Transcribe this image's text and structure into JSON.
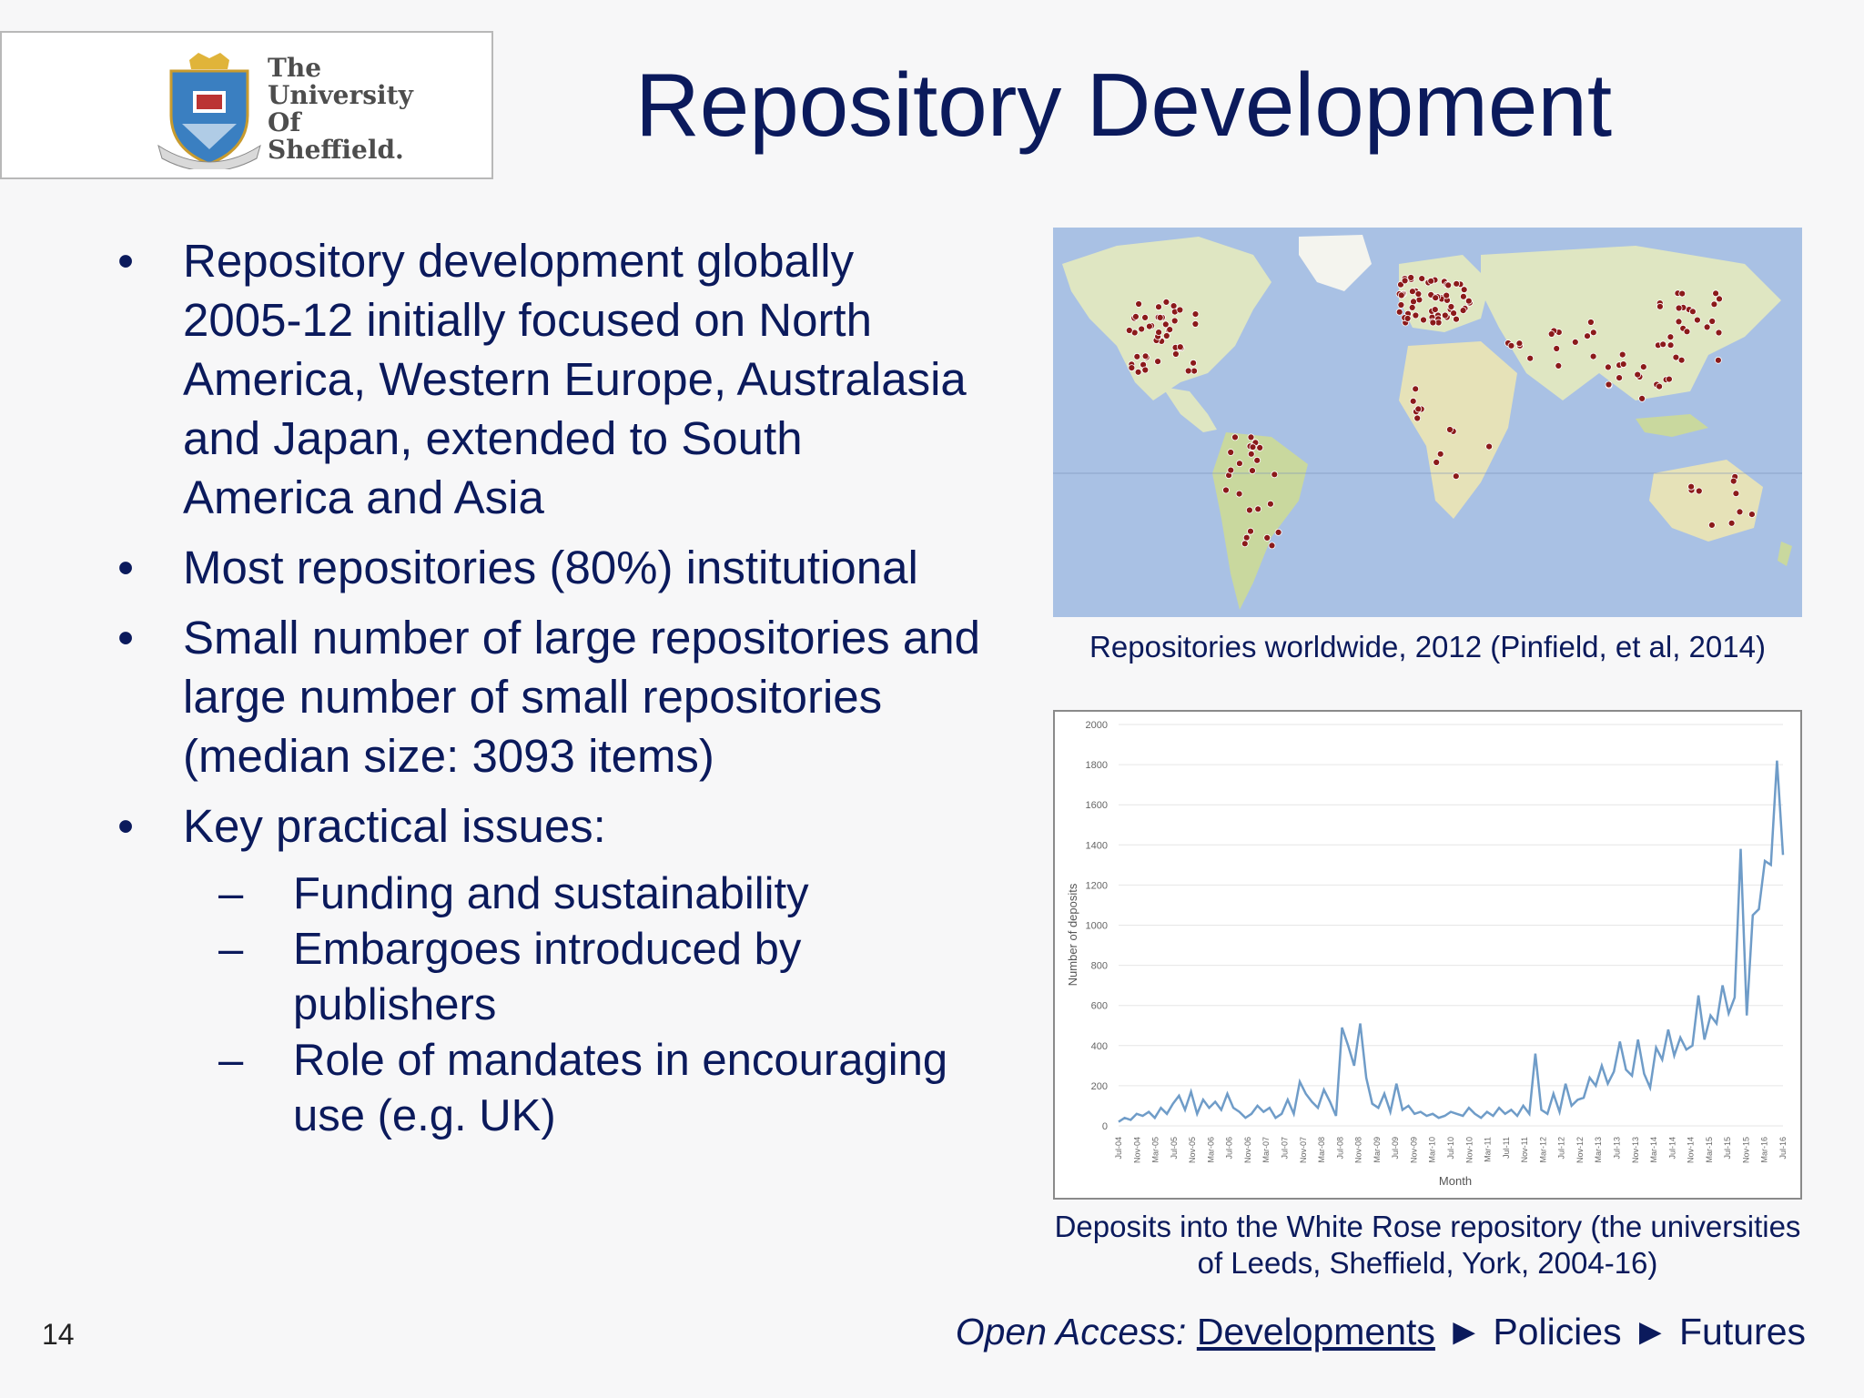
{
  "logo": {
    "lines": [
      "The",
      "University",
      "Of",
      "Sheffield."
    ]
  },
  "title": "Repository Development",
  "bullets": [
    {
      "text": "Repository development globally 2005-12 initially focused on North America, Western Europe, Australasia and Japan, extended to South America and Asia"
    },
    {
      "text": "Most repositories (80%) institutional"
    },
    {
      "text": "Small number of large repositories and large number of small repositories (median size: 3093 items)"
    },
    {
      "text": "Key practical issues:"
    }
  ],
  "sub_bullets": [
    "Funding and sustainability",
    "Embargoes introduced by publishers",
    "Role of mandates in encouraging use (e.g. UK)"
  ],
  "bullet_char": "•",
  "dash_char": "–",
  "map_caption": "Repositories worldwide, 2012 (Pinfield, et al, 2014)",
  "chart_caption": "Deposits into the White Rose repository (the universities of Leeds, Sheffield, York, 2004-16)",
  "slide_number": "14",
  "footer": {
    "prefix": "Open Access:",
    "current": "Developments",
    "arrow": "►",
    "item2": "Policies",
    "item3": "Futures"
  },
  "colors": {
    "title": "#0b1a5c",
    "ocean": "#a9c1e4",
    "land": "#dfe6c2",
    "marker": "#8b1a1a",
    "line": "#6f9cc8"
  },
  "chart_data": {
    "type": "line",
    "ylabel": "Number of deposits",
    "xlabel": "Month",
    "ylim": [
      0,
      2000
    ],
    "yticks": [
      0,
      200,
      400,
      600,
      800,
      1000,
      1200,
      1400,
      1600,
      1800,
      2000
    ],
    "xtick_labels": [
      "Jul-04",
      "Nov-04",
      "Mar-05",
      "Jul-05",
      "Nov-05",
      "Mar-06",
      "Jul-06",
      "Nov-06",
      "Mar-07",
      "Jul-07",
      "Nov-07",
      "Mar-08",
      "Jul-08",
      "Nov-08",
      "Mar-09",
      "Jul-09",
      "Nov-09",
      "Mar-10",
      "Jul-10",
      "Nov-10",
      "Mar-11",
      "Jul-11",
      "Nov-11",
      "Mar-12",
      "Jul-12",
      "Nov-12",
      "Mar-13",
      "Jul-13",
      "Nov-13",
      "Mar-14",
      "Jul-14",
      "Nov-14",
      "Mar-15",
      "Jul-15",
      "Nov-15",
      "Mar-16",
      "Jul-16"
    ],
    "series": [
      {
        "values": [
          20,
          40,
          30,
          60,
          50,
          70,
          40,
          90,
          60,
          110,
          150,
          80,
          170,
          60,
          130,
          90,
          120,
          80,
          160,
          90,
          70,
          40,
          60,
          100,
          70,
          90,
          40,
          60,
          130,
          60,
          220,
          160,
          120,
          90,
          180,
          120,
          50,
          490,
          400,
          300,
          510,
          240,
          110,
          90,
          160,
          70,
          210,
          80,
          100,
          60,
          70,
          50,
          60,
          40,
          50,
          70,
          60,
          50,
          90,
          60,
          40,
          70,
          50,
          90,
          60,
          80,
          50,
          100,
          60,
          360,
          80,
          60,
          160,
          70,
          210,
          100,
          130,
          140,
          240,
          200,
          300,
          210,
          270,
          420,
          280,
          250,
          430,
          260,
          190,
          390,
          330,
          480,
          350,
          440,
          380,
          400,
          650,
          430,
          550,
          510,
          700,
          560,
          640,
          1380,
          550,
          1050,
          1080,
          1320,
          1300,
          1820,
          1350
        ]
      }
    ]
  }
}
